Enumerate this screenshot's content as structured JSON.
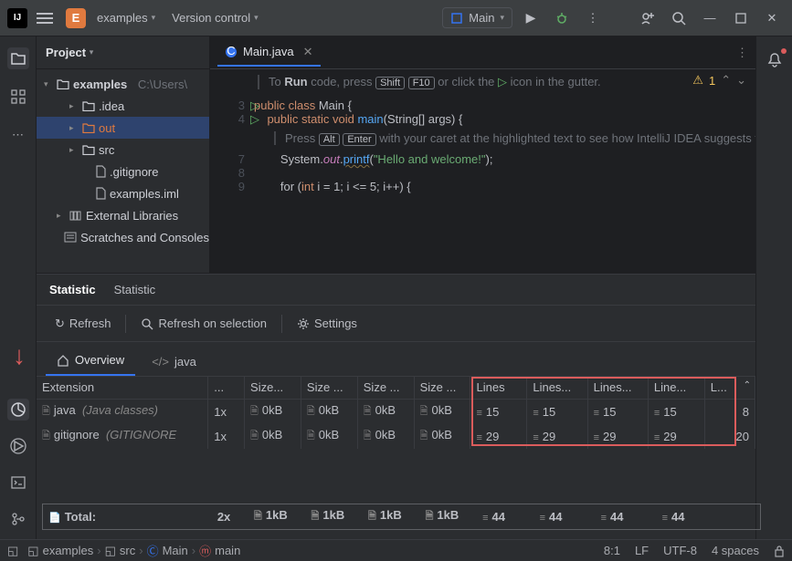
{
  "titlebar": {
    "project_initial": "E",
    "project_name": "examples",
    "vcs_label": "Version control",
    "run_config": "Main"
  },
  "project_panel": {
    "title": "Project",
    "root": {
      "name": "examples",
      "path": "C:\\Users\\"
    },
    "children": [
      {
        "icon": "folder",
        "name": ".idea",
        "expandable": true,
        "indent": 2
      },
      {
        "icon": "folder",
        "name": "out",
        "expandable": true,
        "indent": 2,
        "selected": true,
        "orange": true
      },
      {
        "icon": "folder",
        "name": "src",
        "expandable": true,
        "indent": 2
      },
      {
        "icon": "file",
        "name": ".gitignore",
        "indent": 3
      },
      {
        "icon": "file",
        "name": "examples.iml",
        "indent": 3
      },
      {
        "icon": "lib",
        "name": "External Libraries",
        "expandable": true,
        "indent": 1
      },
      {
        "icon": "scratch",
        "name": "Scratches and Consoles",
        "indent": 1
      }
    ]
  },
  "editor": {
    "tab_name": "Main.java",
    "warning_count": "1",
    "banner_prefix": "To ",
    "banner_run": "Run",
    "banner_mid": " code, press ",
    "key1": "Shift",
    "key2": "F10",
    "banner_suffix": " or click the ",
    "banner_end": " icon in the gutter.",
    "hint2a": "Press ",
    "hint2k1": "Alt",
    "hint2k2": "Enter",
    "hint2b": " with your caret at the highlighted text to see how IntelliJ IDEA suggests fixing it.",
    "line3_no": "3",
    "line4_no": "4",
    "line7_no": "7",
    "line8_no": "8",
    "line9_no": "9",
    "code3": "public class Main {",
    "code4_pre": "    public static void ",
    "code4_fn": "main",
    "code4_post": "(String[] args) {",
    "code7_pre": "        System.",
    "code7_fld": "out",
    "code7_mid": ".",
    "code7_fn": "printf",
    "code7_open": "(",
    "code7_str": "\"Hello and welcome!\"",
    "code7_close": ");",
    "code9_pre": "        for (",
    "code9_kw": "int",
    "code9_mid": " i = 1; i <= 5; i++) {"
  },
  "statistic": {
    "panel_tabs": [
      "Statistic",
      "Statistic"
    ],
    "toolbar": {
      "refresh": "Refresh",
      "refresh_sel": "Refresh on selection",
      "settings": "Settings"
    },
    "subtabs": {
      "overview": "Overview",
      "java": "java"
    },
    "columns": [
      "Extension",
      "...",
      "Size...",
      "Size ...",
      "Size ...",
      "Size ...",
      "Lines",
      "Lines...",
      "Lines...",
      "Line...",
      "L..."
    ],
    "rows": [
      {
        "ext": "java",
        "desc": "(Java classes)",
        "count": "1x",
        "s1": "0kB",
        "s2": "0kB",
        "s3": "0kB",
        "s4": "0kB",
        "l1": "15",
        "l2": "15",
        "l3": "15",
        "l4": "15",
        "l5": "8"
      },
      {
        "ext": "gitignore",
        "desc": "(GITIGNORE",
        "count": "1x",
        "s1": "0kB",
        "s2": "0kB",
        "s3": "0kB",
        "s4": "0kB",
        "l1": "29",
        "l2": "29",
        "l3": "29",
        "l4": "29",
        "l5": "20"
      }
    ],
    "total": {
      "label": "Total:",
      "count": "2x",
      "s": "1kB",
      "l": "44"
    }
  },
  "breadcrumb": [
    "examples",
    "src",
    "Main",
    "main"
  ],
  "statusbar": {
    "pos": "8:1",
    "le": "LF",
    "enc": "UTF-8",
    "indent": "4 spaces"
  }
}
